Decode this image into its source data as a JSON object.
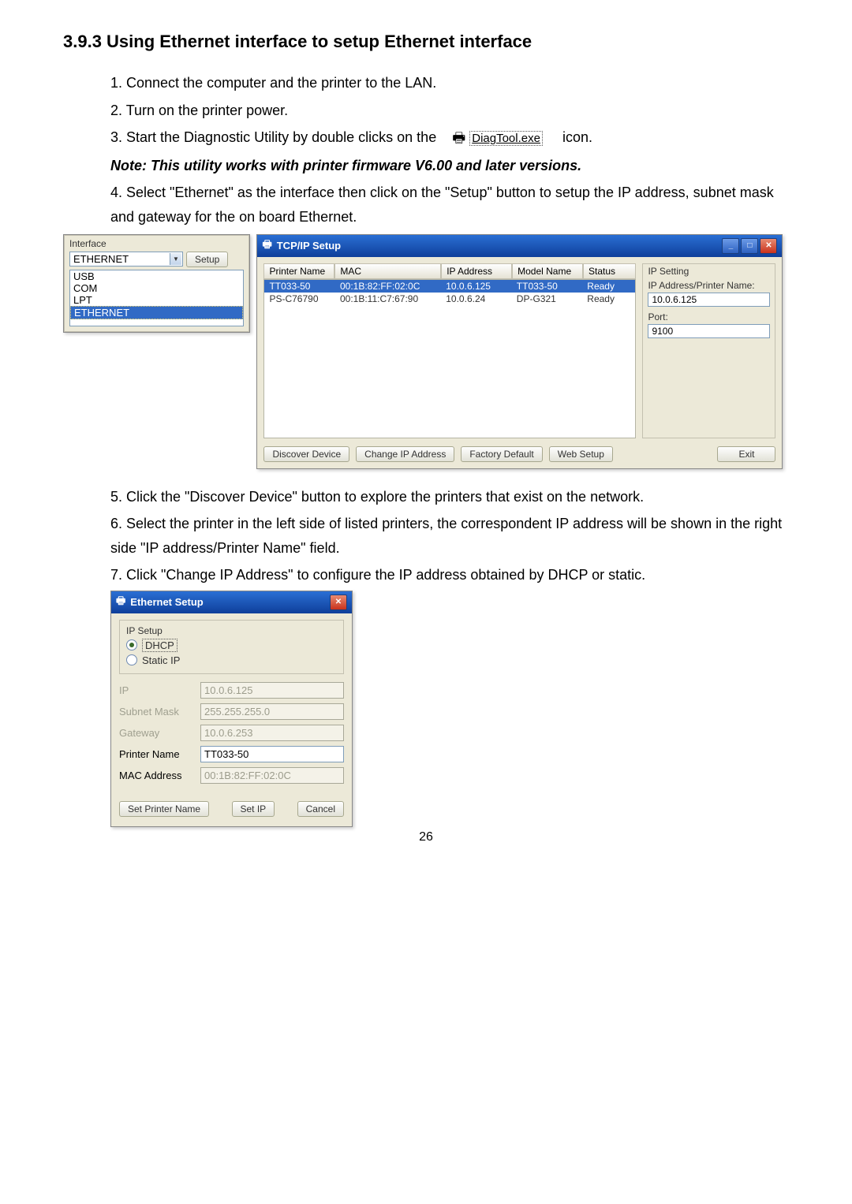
{
  "heading": "3.9.3 Using Ethernet interface to setup Ethernet interface",
  "step1": "1. Connect the computer and the printer to the LAN.",
  "step2": "2. Turn on the printer power.",
  "step3a": "3. Start the Diagnostic Utility by double clicks on the",
  "exe_name": "DiagTool.exe",
  "step3b": "icon.",
  "note": "Note: This utility works with printer firmware V6.00 and later versions.",
  "step4": "4. Select \"Ethernet\" as the interface then click on the \"Setup\" button to setup the IP address, subnet mask and gateway for the on board Ethernet.",
  "interface": {
    "legend": "Interface",
    "selected": "ETHERNET",
    "setup_btn": "Setup",
    "options": [
      "USB",
      "COM",
      "LPT",
      "ETHERNET"
    ]
  },
  "tcpip": {
    "title": "TCP/IP Setup",
    "columns": [
      "Printer Name",
      "MAC",
      "IP Address",
      "Model Name",
      "Status"
    ],
    "rows": [
      {
        "name": "TT033-50",
        "mac": "00:1B:82:FF:02:0C",
        "ip": "10.0.6.125",
        "model": "TT033-50",
        "status": "Ready",
        "selected": true
      },
      {
        "name": "PS-C76790",
        "mac": "00:1B:11:C7:67:90",
        "ip": "10.0.6.24",
        "model": "DP-G321",
        "status": "Ready",
        "selected": false
      }
    ],
    "ip_setting_legend": "IP Setting",
    "ip_addr_label": "IP Address/Printer Name:",
    "ip_addr_value": "10.0.6.125",
    "port_label": "Port:",
    "port_value": "9100",
    "btns": {
      "discover": "Discover Device",
      "change": "Change IP Address",
      "factory": "Factory Default",
      "web": "Web Setup",
      "exit": "Exit"
    }
  },
  "step5": "5. Click the \"Discover Device\" button to explore the printers that exist on the network.",
  "step6": "6. Select the printer in the left side of listed printers, the correspondent IP address will be shown in the right side \"IP address/Printer Name\" field.",
  "step7": "7. Click \"Change IP Address\" to configure the IP address obtained by DHCP or static.",
  "eth_setup": {
    "title": "Ethernet Setup",
    "ip_setup_legend": "IP Setup",
    "dhcp": "DHCP",
    "static": "Static IP",
    "fields": {
      "ip_lbl": "IP",
      "ip_val": "10.0.6.125",
      "mask_lbl": "Subnet Mask",
      "mask_val": "255.255.255.0",
      "gw_lbl": "Gateway",
      "gw_val": "10.0.6.253",
      "pn_lbl": "Printer Name",
      "pn_val": "TT033-50",
      "mac_lbl": "MAC Address",
      "mac_val": "00:1B:82:FF:02:0C"
    },
    "btns": {
      "set_name": "Set Printer Name",
      "set_ip": "Set IP",
      "cancel": "Cancel"
    }
  },
  "page_num": "26"
}
